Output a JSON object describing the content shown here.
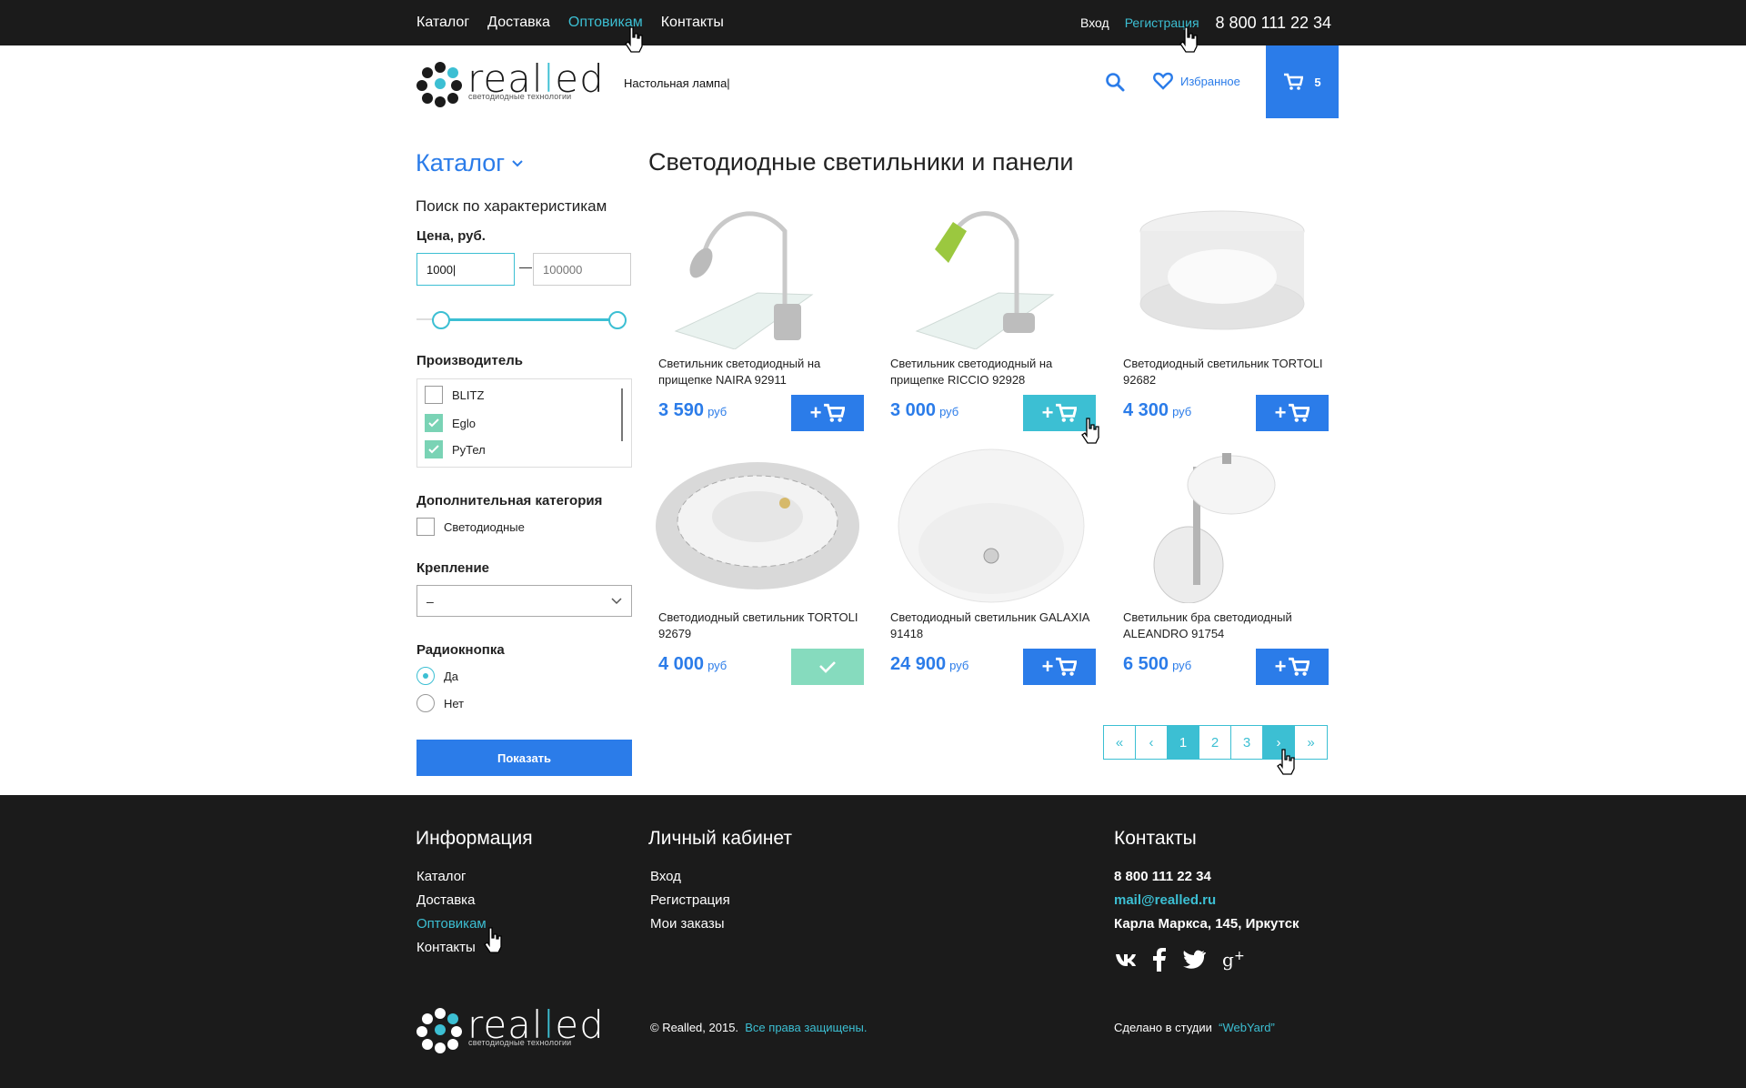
{
  "topbar": {
    "nav": [
      "Каталог",
      "Доставка",
      "Оптовикам",
      "Контакты"
    ],
    "active_nav": "Оптовикам",
    "login": "Вход",
    "register": "Регистрация",
    "phone": "8 800 111 22 34"
  },
  "header": {
    "logo_word_a": "real",
    "logo_word_b": "l",
    "logo_word_c": "ed",
    "logo_sub": "светодиодные технологии",
    "search_value": "Настольная лампа|",
    "favorites": "Избранное",
    "cart_count": "5"
  },
  "sidebar": {
    "catalog_title": "Каталог",
    "filter_title": "Поиск по характеристикам",
    "price_label": "Цена, руб.",
    "price_from": "1000|",
    "price_to_placeholder": "100000",
    "price_dash": "—",
    "price_slider_range": [
      0.12,
      0.98
    ],
    "manufacturer_label": "Производитель",
    "manufacturers": [
      {
        "name": "BLITZ",
        "checked": false
      },
      {
        "name": "Eglo",
        "checked": true
      },
      {
        "name": "РуТел",
        "checked": true
      }
    ],
    "extra_category_label": "Дополнительная категория",
    "extra_category_option": "Светодиодные",
    "mount_label": "Крепление",
    "mount_value": "–",
    "radio_label": "Радиокнопка",
    "radio_yes": "Да",
    "radio_no": "Нет",
    "show_button": "Показать"
  },
  "main": {
    "title": "Светодиодные светильники и панели",
    "currency": "руб",
    "products": [
      {
        "name": "Светильник светодиодный на прищепке NAIRA 92911",
        "price": "3 590",
        "state": "normal"
      },
      {
        "name": "Светильник светодиодный на прищепке RICCIO 92928",
        "price": "3 000",
        "state": "hover"
      },
      {
        "name": "Светодиодный светильник TORTOLI 92682",
        "price": "4 300",
        "state": "normal"
      },
      {
        "name": "Светодиодный светильник TORTOLI 92679",
        "price": "4 000",
        "state": "added"
      },
      {
        "name": "Светодиодный светильник GALAXIA 91418",
        "price": "24 900",
        "state": "normal"
      },
      {
        "name": "Светильник бра светодиодный ALEANDRO 91754",
        "price": "6 500",
        "state": "normal"
      }
    ],
    "pager": {
      "first": "«",
      "prev": "‹",
      "pages": [
        "1",
        "2",
        "3"
      ],
      "current": "1",
      "next": "›",
      "last": "»"
    }
  },
  "footer": {
    "info_title": "Информация",
    "info_links": [
      "Каталог",
      "Доставка",
      "Оптовикам",
      "Контакты"
    ],
    "cabinet_title": "Личный кабинет",
    "cabinet_links": [
      "Вход",
      "Регистрация",
      "Мои заказы"
    ],
    "contacts_title": "Контакты",
    "phone": "8 800 111 22 34",
    "email": "mail@realled.ru",
    "address": "Карла Маркса, 145, Иркутск",
    "copyright": "© Realled, 2015.",
    "rights": "Все права защищены.",
    "made_by": "Сделано в студии",
    "studio": "“WebYard”"
  },
  "colors": {
    "blue": "#2b7ce9",
    "cyan": "#3cbfd3",
    "green": "#86dbbe",
    "dark": "#1b1b1b"
  }
}
